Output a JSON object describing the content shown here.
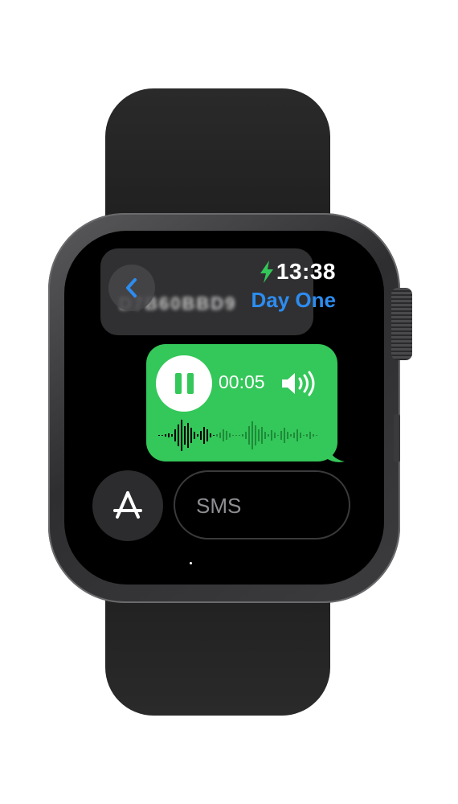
{
  "status": {
    "time": "13:38",
    "app_name": "Day One",
    "charging": true
  },
  "previous_message": {
    "text": "D7B60BBD9"
  },
  "voice_message": {
    "duration": "00:05",
    "state": "playing",
    "bubble_color": "#34c759"
  },
  "compose": {
    "placeholder": "SMS"
  },
  "icons": {
    "back": "chevron-left-icon",
    "charging": "bolt-icon",
    "pause": "pause-icon",
    "speaker": "speaker-wave-icon",
    "app_store": "app-store-icon"
  },
  "colors": {
    "accent": "#2d8cf0",
    "charging": "#34c759",
    "message_bubble": "#34c759"
  }
}
